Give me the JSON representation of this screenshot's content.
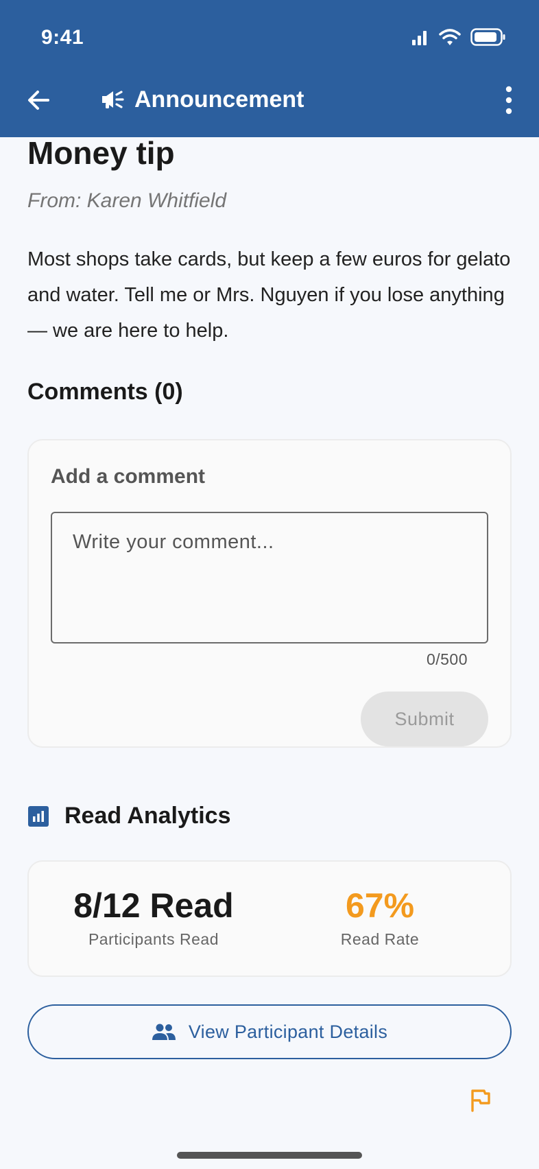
{
  "status_bar": {
    "time": "9:41"
  },
  "toolbar": {
    "title": "Announcement",
    "back_icon": "arrow-back-icon",
    "title_icon": "campaign-icon",
    "more_icon": "more-vert-icon"
  },
  "post": {
    "title": "Money tip",
    "from": "From: Karen Whitfield",
    "body": "Most shops take cards, but keep a few euros for gelato and water. Tell me or Mrs. Nguyen if you lose anything — we are here to help."
  },
  "comments": {
    "title": "Comments (0)",
    "card_title": "Add a comment",
    "placeholder": "Write your comment...",
    "char_count": "0/500",
    "submit_label": "Submit"
  },
  "analytics": {
    "title": "Read Analytics",
    "icon": "analytics-icon",
    "read_value": "8/12 Read",
    "read_label": "Participants Read",
    "rate_value": "67%",
    "rate_label": "Read Rate"
  },
  "participants_button": {
    "label": "View Participant Details",
    "icon": "people-icon"
  },
  "flag_icon": "flag-icon",
  "colors": {
    "primary": "#2c5f9e",
    "accent": "#f39a1e",
    "background": "#f6f8fc"
  }
}
